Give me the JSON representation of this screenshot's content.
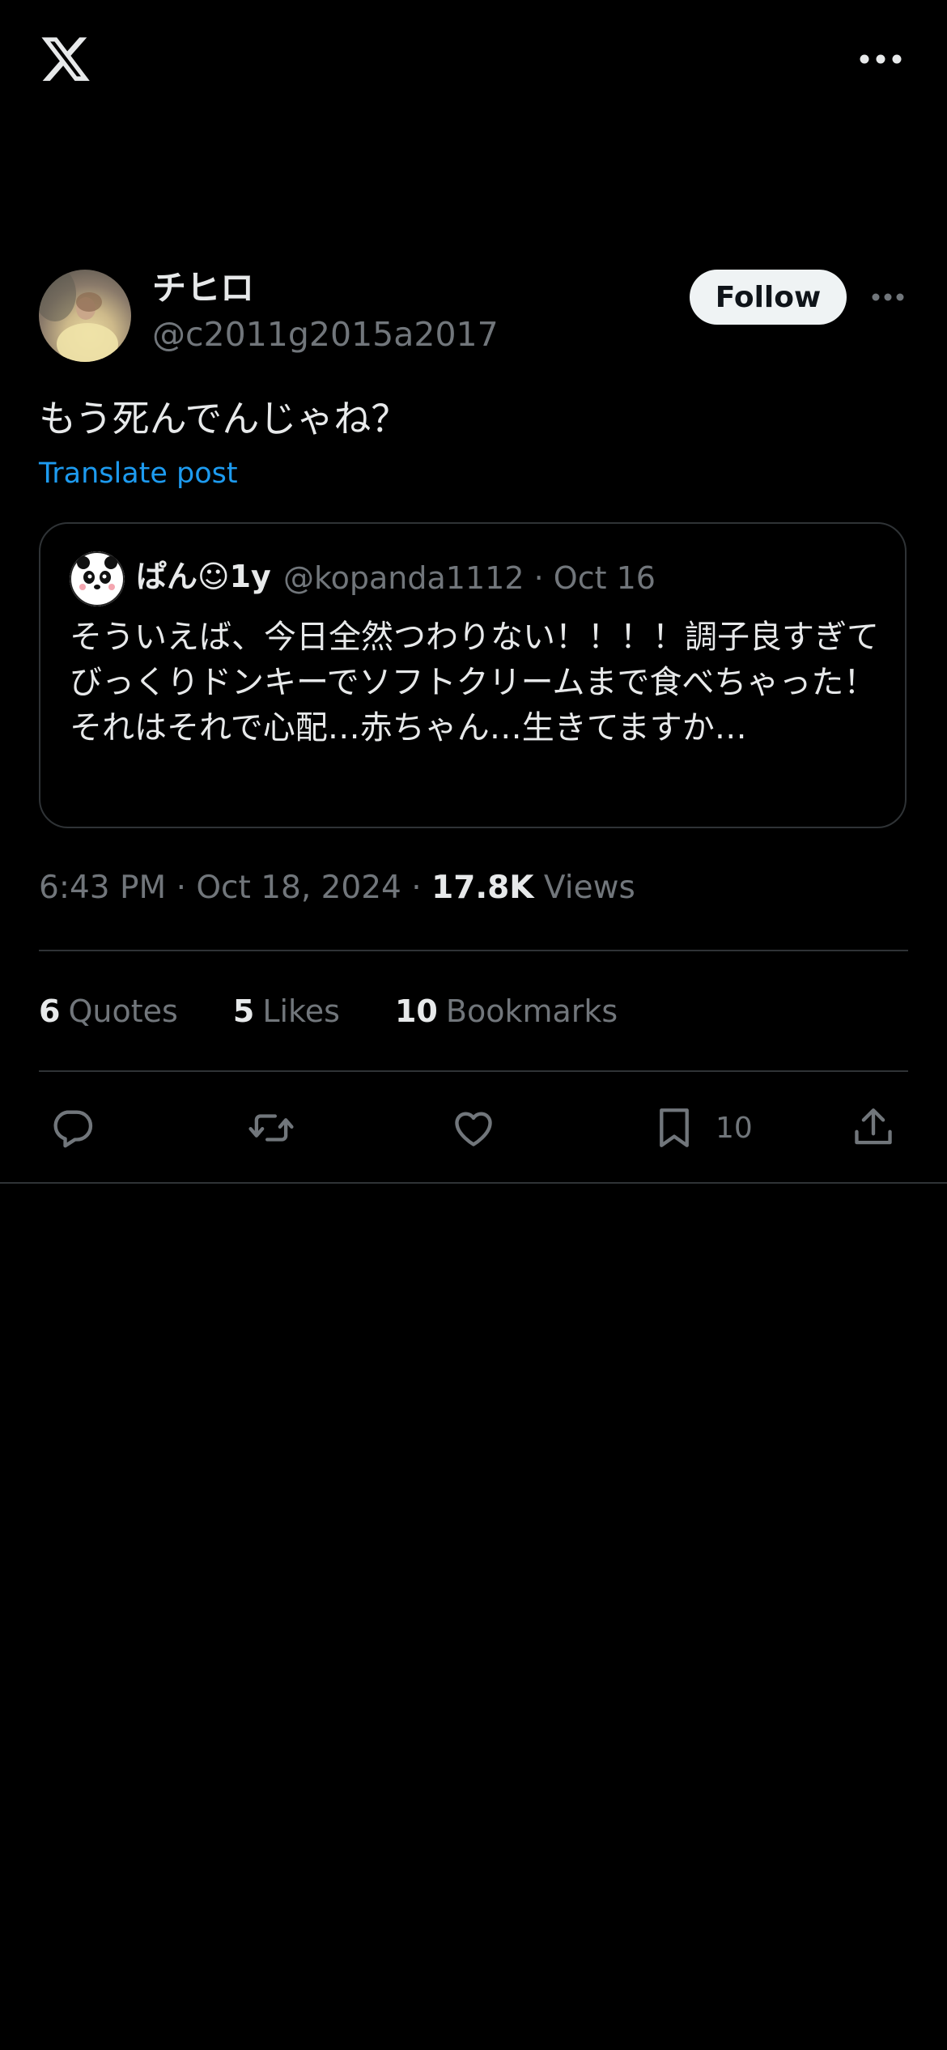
{
  "header": {
    "logo_icon": "x-logo-icon",
    "more_icon": "more-horizontal-icon"
  },
  "post": {
    "author_name": "チヒロ",
    "author_handle": "@c2011g2015a2017",
    "follow_label": "Follow",
    "text": "もう死んでんじゃね？",
    "translate_label": "Translate post",
    "time": "6:43 PM",
    "date": "Oct 18, 2024",
    "views_count": "17.8K",
    "views_label": "Views"
  },
  "quote": {
    "author_name": "ぱん☺1y",
    "author_handle": "@kopanda1112",
    "date": "Oct 16",
    "text": "そういえば、今日全然つわりない！！！！調子良すぎてびっくりドンキーでソフトクリームまで食べちゃった！それはそれで心配…赤ちゃん…生きてますか…"
  },
  "stats": {
    "quotes_count": "6",
    "quotes_label": "Quotes",
    "likes_count": "5",
    "likes_label": "Likes",
    "bookmarks_count": "10",
    "bookmarks_label": "Bookmarks"
  },
  "actions": {
    "reply_icon": "reply-icon",
    "repost_icon": "repost-icon",
    "like_icon": "heart-icon",
    "bookmark_icon": "bookmark-icon",
    "bookmark_count": "10",
    "share_icon": "share-icon"
  },
  "colors": {
    "background": "#000000",
    "text_primary": "#e7e9ea",
    "text_secondary": "#71767b",
    "link": "#1d9bf0",
    "border": "#2f3336"
  }
}
